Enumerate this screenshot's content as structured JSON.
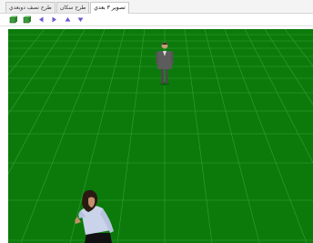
{
  "tabs": [
    {
      "label": "طرح نصف دوبعدي",
      "active": false
    },
    {
      "label": "طرح سکان",
      "active": false
    },
    {
      "label": "تصوير ۳ بعدي",
      "active": true
    }
  ],
  "toolbar": {
    "buttons": [
      {
        "icon": "green-cube-icon",
        "color": "#3b9b3b"
      },
      {
        "icon": "green-cube-icon",
        "color": "#3b9b3b"
      },
      {
        "icon": "arrow-left-icon",
        "color": "#6a5acd"
      },
      {
        "icon": "arrow-right-icon",
        "color": "#6a5acd"
      },
      {
        "icon": "arrow-up-icon",
        "color": "#6a5acd"
      },
      {
        "icon": "arrow-down-icon",
        "color": "#6a5acd"
      }
    ]
  },
  "scene": {
    "floor_color": "#0b7a0b",
    "grid_color": "#3fa53f",
    "figures": [
      {
        "name": "man-in-suit",
        "suit_color": "#5c5c5c"
      },
      {
        "name": "woman-in-blouse",
        "blouse_color": "#c9d3ea",
        "hair_color": "#2a1a12"
      }
    ]
  }
}
